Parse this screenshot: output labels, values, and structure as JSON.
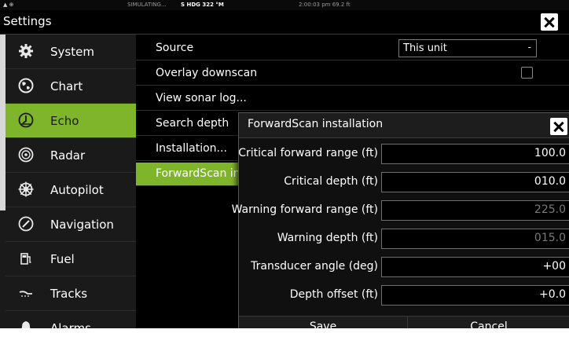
{
  "status_bar": {
    "icons": "▲ ⊕",
    "simulating": "SIMULATING...",
    "heading": "S HDG 322 °M",
    "time_depth": "2:00:03 pm  69.2 ft"
  },
  "window": {
    "title": "Settings"
  },
  "sidebar": {
    "items": [
      {
        "label": "System",
        "icon": "gear-icon"
      },
      {
        "label": "Chart",
        "icon": "globe-icon"
      },
      {
        "label": "Echo",
        "icon": "echo-icon",
        "active": true
      },
      {
        "label": "Radar",
        "icon": "radar-icon"
      },
      {
        "label": "Autopilot",
        "icon": "helm-icon"
      },
      {
        "label": "Navigation",
        "icon": "compass-icon"
      },
      {
        "label": "Fuel",
        "icon": "fuel-icon"
      },
      {
        "label": "Tracks",
        "icon": "tracks-icon"
      },
      {
        "label": "Alarms",
        "icon": "bell-icon"
      }
    ]
  },
  "settings": {
    "rows": [
      {
        "label": "Source"
      },
      {
        "label": "Overlay downscan"
      },
      {
        "label": "View sonar log..."
      },
      {
        "label": "Search depth"
      },
      {
        "label": "Installation..."
      },
      {
        "label": "ForwardScan installation...",
        "active": true
      }
    ],
    "source_value": "This unit",
    "source_caret": "-",
    "overlay_downscan_checked": false
  },
  "dialog": {
    "title": "ForwardScan installation",
    "fields": [
      {
        "label": "Critical forward range (ft)",
        "value": "100.0"
      },
      {
        "label": "Critical depth (ft)",
        "value": "010.0"
      },
      {
        "label": "Warning forward range (ft)",
        "value": "225.0",
        "dim": true
      },
      {
        "label": "Warning depth (ft)",
        "value": "015.0",
        "dim": true
      },
      {
        "label": "Transducer angle (deg)",
        "value": "+00"
      },
      {
        "label": "Depth offset (ft)",
        "value": "+0.0"
      }
    ],
    "save_label": "Save",
    "cancel_label": "Cancel"
  },
  "colors": {
    "accent": "#7fb52a",
    "background": "#000000"
  }
}
